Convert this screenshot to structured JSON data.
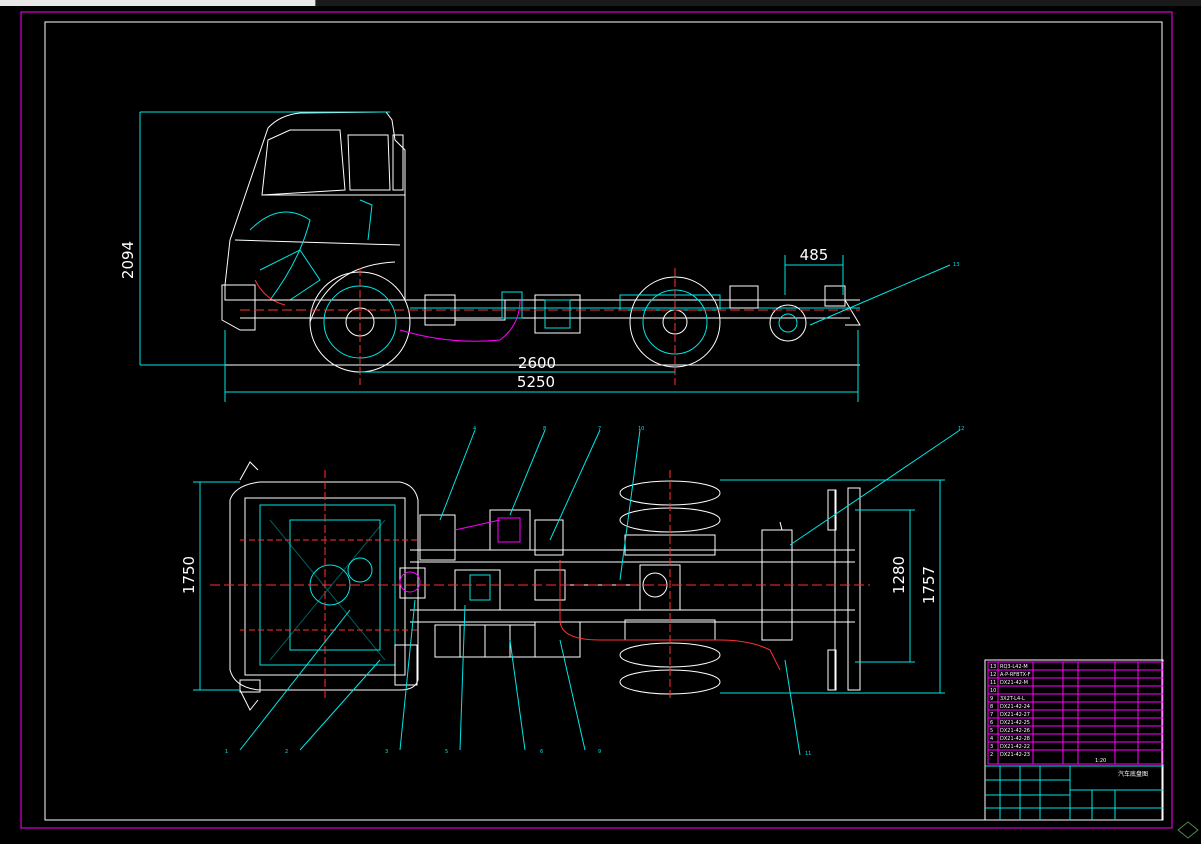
{
  "colors": {
    "background": "#000000",
    "border": "#ff00ff",
    "frame": "#ffffff",
    "dimension": "#00e5e5",
    "centerline": "#ff3030",
    "detail": "#00e5e5"
  },
  "dimensions": {
    "cab_height": "2094",
    "rear_overhang": "485",
    "wheelbase": "2600",
    "overall_length": "5250",
    "front_track": "1750",
    "rear_frame_width": "1280",
    "rear_track": "1757"
  },
  "callouts": [
    "1",
    "2",
    "3",
    "4",
    "5",
    "6",
    "7",
    "8",
    "9",
    "10",
    "11",
    "12",
    "13"
  ],
  "title_block": {
    "title": "汽车底盘图",
    "scale": "1:20",
    "rows": [
      {
        "no": "13",
        "code": "RQ3-L42-M"
      },
      {
        "no": "12",
        "code": "A-P-RFBTX-F"
      },
      {
        "no": "11",
        "code": "DX21-42-M"
      },
      {
        "no": "10",
        "code": ""
      },
      {
        "no": "9",
        "code": "3X2T-L4-L"
      },
      {
        "no": "8",
        "code": "DX21-42-24"
      },
      {
        "no": "7",
        "code": "DX21-42-27"
      },
      {
        "no": "6",
        "code": "DX21-42-25"
      },
      {
        "no": "5",
        "code": "DX21-42-26"
      },
      {
        "no": "4",
        "code": "DX21-42-28"
      },
      {
        "no": "3",
        "code": "DX21-42-22"
      },
      {
        "no": "2",
        "code": "DX21-42-23"
      }
    ]
  }
}
